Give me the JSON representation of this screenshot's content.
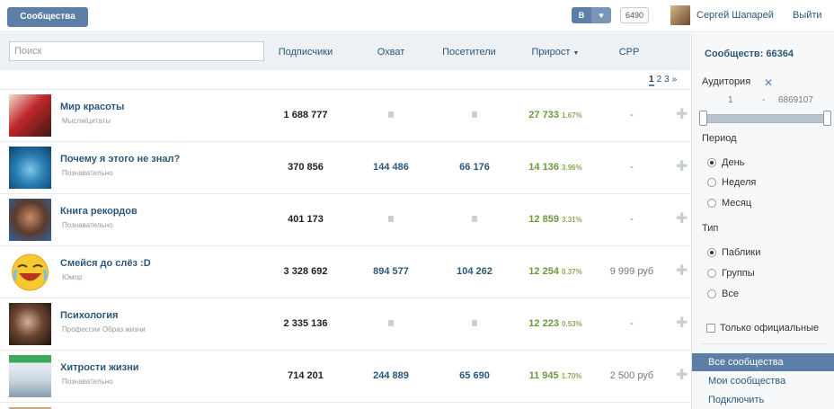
{
  "topbar": {
    "brand_label": "Сообщества",
    "vk_label": "В",
    "heart_label": "♥",
    "count": "6490",
    "user_name": "Сергей Шапарей",
    "logout_label": "Выйти"
  },
  "search": {
    "placeholder": "Поиск"
  },
  "columns": {
    "subscribers": "Подписчики",
    "reach": "Охват",
    "visitors": "Посетители",
    "growth": "Прирост",
    "cpp": "СРР"
  },
  "pager": {
    "pages": [
      "1",
      "2",
      "3"
    ],
    "next": "»"
  },
  "rows": [
    {
      "name": "Мир красоты",
      "category": "Мысли/цитаты",
      "subscribers": "1 688 777",
      "reach": "",
      "visitors": "",
      "growth": "27 733",
      "growth_pct": "1.67%",
      "cpp": "-"
    },
    {
      "name": "Почему я этого не знал?",
      "category": "Познавательно",
      "subscribers": "370 856",
      "reach": "144 486",
      "visitors": "66 176",
      "growth": "14 136",
      "growth_pct": "3.96%",
      "cpp": "-"
    },
    {
      "name": "Книга рекордов",
      "category": "Познавательно",
      "subscribers": "401 173",
      "reach": "",
      "visitors": "",
      "growth": "12 859",
      "growth_pct": "3.31%",
      "cpp": "-"
    },
    {
      "name": "Смейся до слёз :D",
      "category": "Юмор",
      "subscribers": "3 328 692",
      "reach": "894 577",
      "visitors": "104 262",
      "growth": "12 254",
      "growth_pct": "0.37%",
      "cpp": "9 999 руб"
    },
    {
      "name": "Психология",
      "category": "Профессии Образ жизни",
      "subscribers": "2 335 136",
      "reach": "",
      "visitors": "",
      "growth": "12 223",
      "growth_pct": "0.53%",
      "cpp": "-"
    },
    {
      "name": "Хитрости жизни",
      "category": "Познавательно",
      "subscribers": "714 201",
      "reach": "244 889",
      "visitors": "65 690",
      "growth": "11 945",
      "growth_pct": "1.70%",
      "cpp": "2 500 руб"
    }
  ],
  "sidebar": {
    "total": "Сообществ: 66364",
    "audience_label": "Аудитория",
    "range_min": "1",
    "range_dash": "-",
    "range_max": "6869107",
    "period_label": "Период",
    "period_options": [
      "День",
      "Неделя",
      "Месяц"
    ],
    "type_label": "Тип",
    "type_options": [
      "Паблики",
      "Группы",
      "Все"
    ],
    "official_label": "Только официальные",
    "nav": [
      "Все сообщества",
      "Мои сообщества",
      "Подключить"
    ]
  },
  "colors": {
    "accent": "#5b7fa6",
    "link": "#2b587a",
    "growth": "#6a9a3a"
  }
}
